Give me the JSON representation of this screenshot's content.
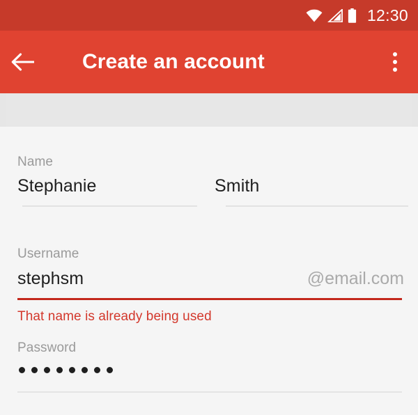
{
  "status_bar": {
    "time": "12:30",
    "icons": [
      "wifi-icon",
      "cellular-signal-icon",
      "battery-icon"
    ],
    "background_color": "#c63a2a"
  },
  "toolbar": {
    "title": "Create an account",
    "back_icon": "back-arrow-icon",
    "overflow_icon": "overflow-menu-icon",
    "background_color": "#e04331",
    "text_color": "#ffffff"
  },
  "form": {
    "name_field": {
      "label": "Name",
      "first_name_value": "Stephanie",
      "last_name_value": "Smith"
    },
    "username_field": {
      "label": "Username",
      "value": "stephsm",
      "suffix": "@email.com",
      "error": "That name is already being used",
      "error_color": "#d3382c",
      "underline_color": "#c3281c"
    },
    "password_field": {
      "label": "Password",
      "masked_value": "••••••••",
      "character_count": 8
    }
  }
}
